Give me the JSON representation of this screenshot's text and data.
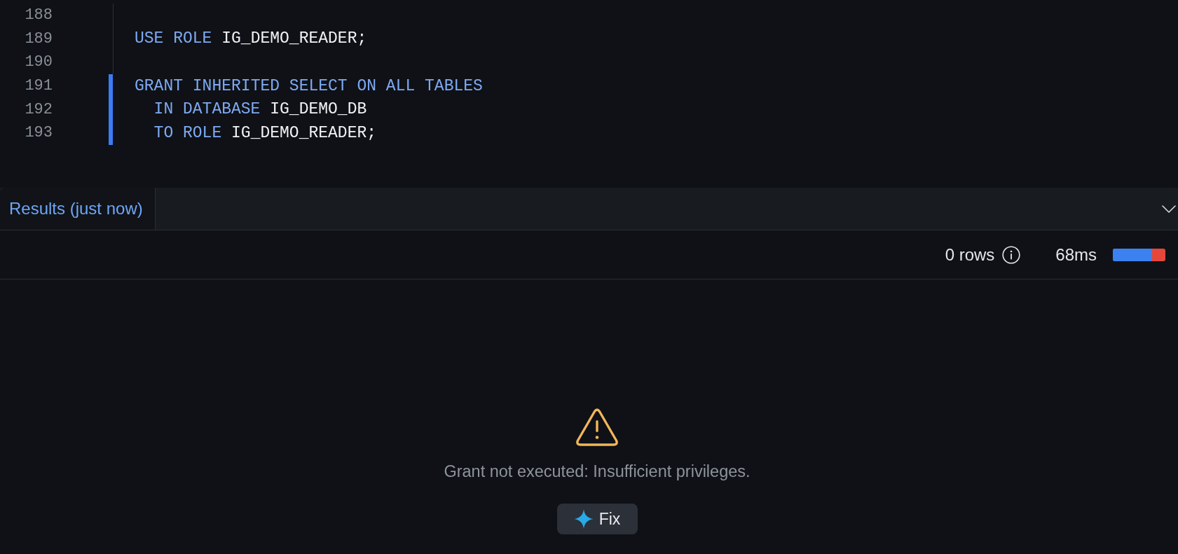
{
  "editor": {
    "lines": [
      {
        "number": "188",
        "selected": false
      },
      {
        "number": "189",
        "selected": false,
        "indented": false,
        "tokens": [
          {
            "kind": "keyword",
            "text": "USE ROLE"
          },
          {
            "kind": "identifier",
            "text": "IG_DEMO_READER;"
          }
        ]
      },
      {
        "number": "190",
        "selected": false
      },
      {
        "number": "191",
        "selected": true,
        "indented": false,
        "tokens": [
          {
            "kind": "keyword",
            "text": "GRANT INHERITED SELECT ON ALL TABLES"
          }
        ]
      },
      {
        "number": "192",
        "selected": true,
        "indented": true,
        "tokens": [
          {
            "kind": "keyword",
            "text": "IN DATABASE"
          },
          {
            "kind": "identifier",
            "text": "IG_DEMO_DB"
          }
        ]
      },
      {
        "number": "193",
        "selected": true,
        "indented": true,
        "tokens": [
          {
            "kind": "keyword",
            "text": "TO ROLE"
          },
          {
            "kind": "identifier",
            "text": "IG_DEMO_READER;"
          }
        ]
      }
    ]
  },
  "results_panel": {
    "tabs": [
      {
        "label": "Results (just now)",
        "selected": true
      }
    ]
  },
  "status": {
    "row_count": "0 rows",
    "duration": "68ms",
    "timing_bar": {
      "level": 0.74
    }
  },
  "error": {
    "message": "Grant not executed: Insufficient privileges.",
    "action": "Fix"
  }
}
